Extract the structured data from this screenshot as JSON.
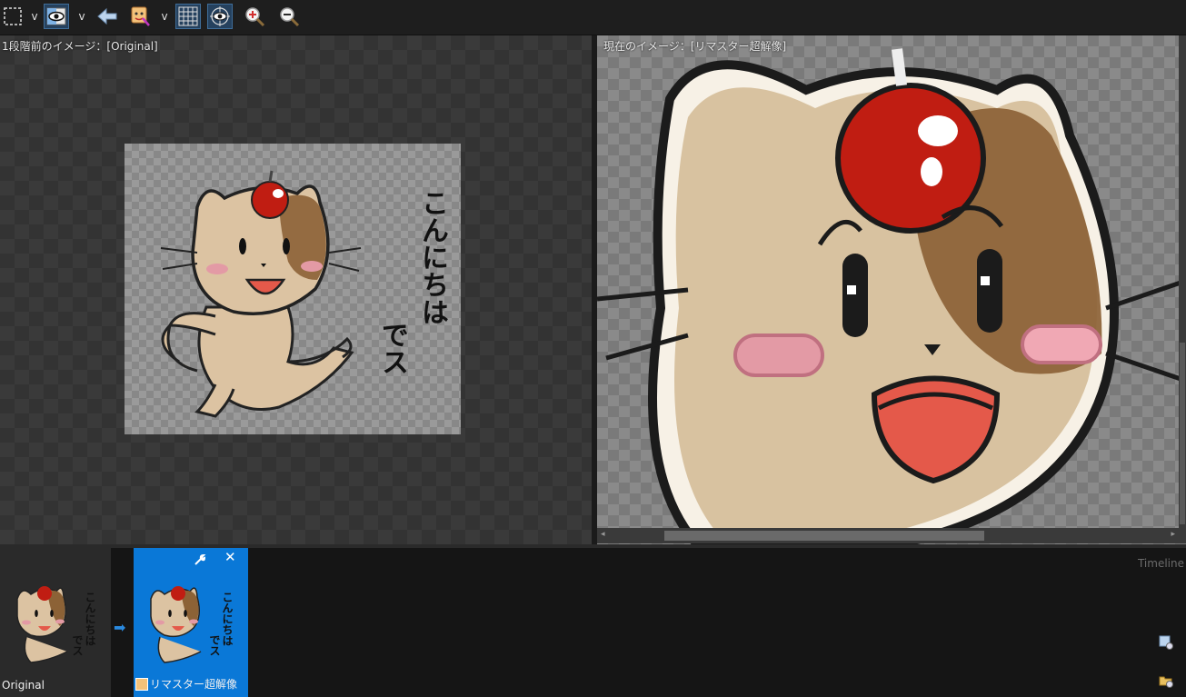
{
  "toolbar": {
    "dropdown_glyph": "v",
    "buttons": [
      {
        "name": "selection-tool",
        "icon": "dashed-rectangle-icon"
      },
      {
        "name": "preview-mode",
        "icon": "eye-split-icon",
        "active": true
      },
      {
        "name": "back",
        "icon": "arrow-left-icon"
      },
      {
        "name": "face-tool",
        "icon": "face-brush-icon"
      },
      {
        "name": "grid",
        "icon": "grid-icon",
        "active": true
      },
      {
        "name": "target-view",
        "icon": "eye-target-icon",
        "active": true
      },
      {
        "name": "zoom-in",
        "icon": "zoom-in-icon"
      },
      {
        "name": "zoom-out",
        "icon": "zoom-out-icon"
      }
    ]
  },
  "left_pane": {
    "label": "1段階前のイメージ：[Original]",
    "image_text_line1": "こんにちは",
    "image_text_line2": "でス"
  },
  "right_pane": {
    "label": "現在のイメージ：[リマスター超解像]"
  },
  "scrollbar": {
    "left_arrow": "◂",
    "right_arrow": "▸"
  },
  "timeline": {
    "label": "Timeline",
    "arrow": "➡",
    "items": [
      {
        "caption": "Original",
        "selected": false,
        "text1": "こんにちは",
        "text2": "でス"
      },
      {
        "caption": "リマスター超解像",
        "selected": true,
        "text1": "こんにちは",
        "text2": "でス",
        "tool_icon": "wrench-icon",
        "close_icon": "close-icon",
        "close_glyph": "✕"
      }
    ],
    "side_icons": [
      "export-icon",
      "open-folder-icon"
    ]
  },
  "colors": {
    "accent": "#0a78d7",
    "toolbar_bg": "#1e1e1e",
    "timeline_bg": "#151515"
  }
}
